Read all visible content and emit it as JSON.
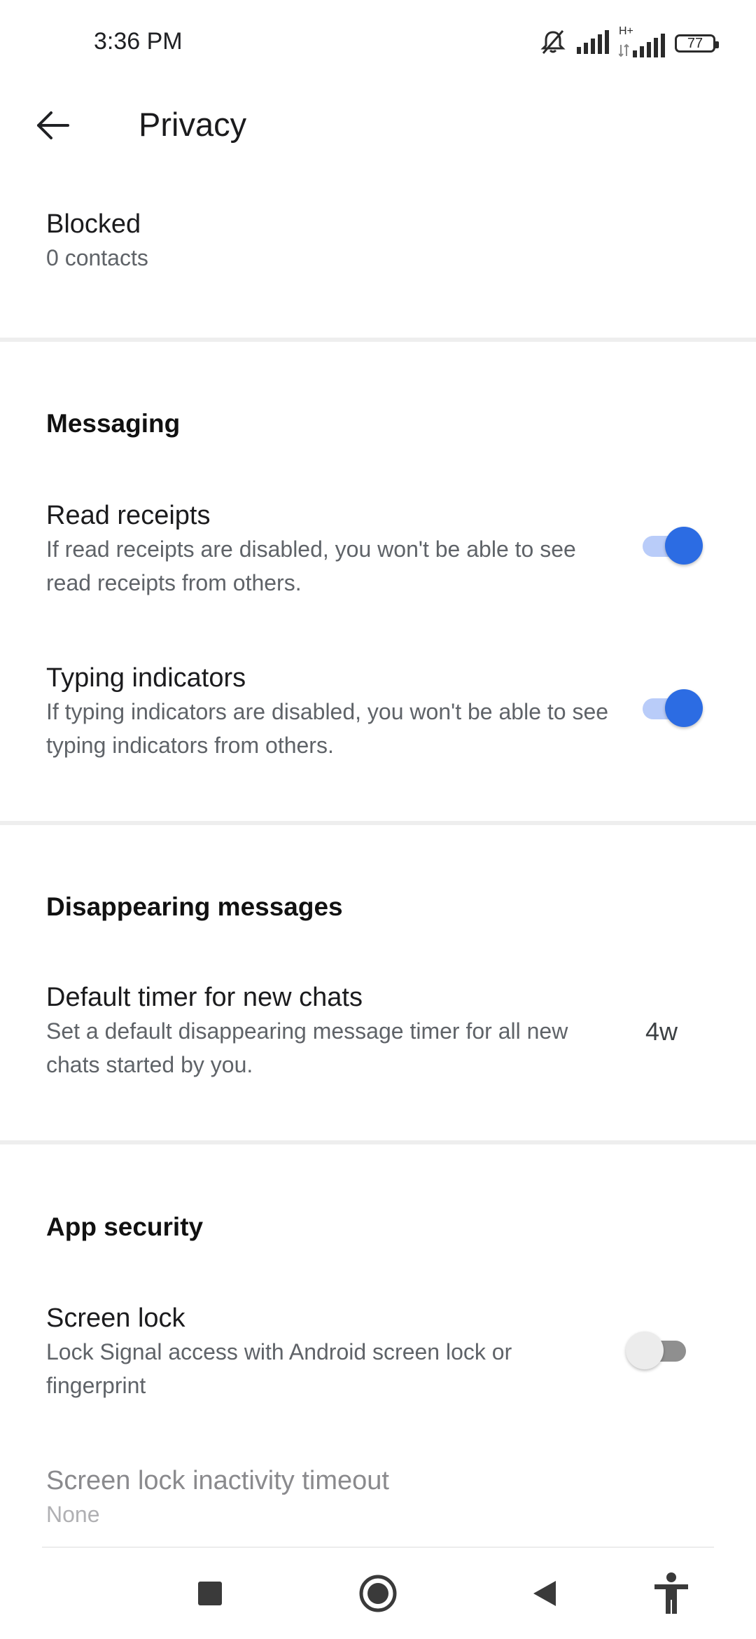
{
  "status_bar": {
    "time": "3:36 PM",
    "network_label": "H+",
    "battery": "77",
    "icons": [
      "bell-off-icon",
      "signal-icon",
      "signal-h-plus-icon",
      "battery-icon"
    ]
  },
  "toolbar": {
    "title": "Privacy",
    "back_icon": "arrow-left-icon"
  },
  "blocked": {
    "title": "Blocked",
    "subtitle": "0 contacts"
  },
  "messaging": {
    "header": "Messaging",
    "read_receipts": {
      "title": "Read receipts",
      "description": "If read receipts are disabled, you won't be able to see read receipts from others.",
      "enabled": true
    },
    "typing_indicators": {
      "title": "Typing indicators",
      "description": "If typing indicators are disabled, you won't be able to see typing indicators from others.",
      "enabled": true
    }
  },
  "disappearing": {
    "header": "Disappearing messages",
    "default_timer": {
      "title": "Default timer for new chats",
      "description": "Set a default disappearing message timer for all new chats started by you.",
      "value": "4w"
    }
  },
  "app_security": {
    "header": "App security",
    "screen_lock": {
      "title": "Screen lock",
      "description": "Lock Signal access with Android screen lock or fingerprint",
      "enabled": false
    },
    "inactivity_timeout": {
      "title": "Screen lock inactivity timeout",
      "value": "None"
    }
  },
  "colors": {
    "accent": "#2c6ce3",
    "accent_track": "#b9ccf9",
    "divider": "#eeeeee"
  },
  "nav_bar": {
    "icons": [
      "recents-square-icon",
      "home-circle-icon",
      "back-triangle-icon",
      "accessibility-icon"
    ]
  }
}
